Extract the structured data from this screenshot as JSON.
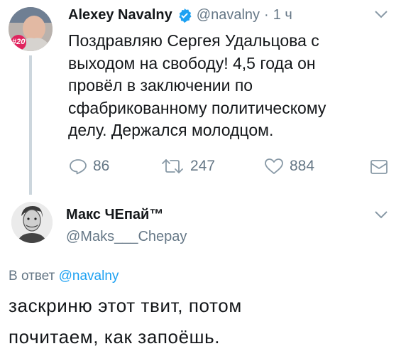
{
  "tweet1": {
    "author_name": "Alexey Navalny",
    "handle": "@navalny",
    "separator": "·",
    "time": "1 ч",
    "avatar_badge": "#20",
    "text_lines": [
      "Поздравляю Сергея Удальцова с",
      "выходом на свободу! 4,5 года он",
      "провёл в заключении по",
      "сфабрикованному политическому",
      "делу. Держался молодцом."
    ],
    "reply_count": "86",
    "retweet_count": "247",
    "like_count": "884"
  },
  "tweet2": {
    "author_name": "Макс ЧЕпай™",
    "handle": "@Maks___Chepay",
    "reply_to_prefix": "В ответ",
    "reply_to_handle": "@navalny",
    "text_lines": [
      "заскриню этот твит, потом",
      "почитаем, как запоёшь."
    ]
  },
  "icons": {
    "verified": "verified-badge-icon",
    "more": "chevron-down-icon",
    "reply": "reply-icon",
    "retweet": "retweet-icon",
    "like": "heart-icon",
    "dm": "envelope-icon"
  },
  "colors": {
    "verified_blue": "#1da1f2",
    "secondary_text": "#657786",
    "link": "#1da1f2",
    "badge_red": "#e0245e"
  }
}
